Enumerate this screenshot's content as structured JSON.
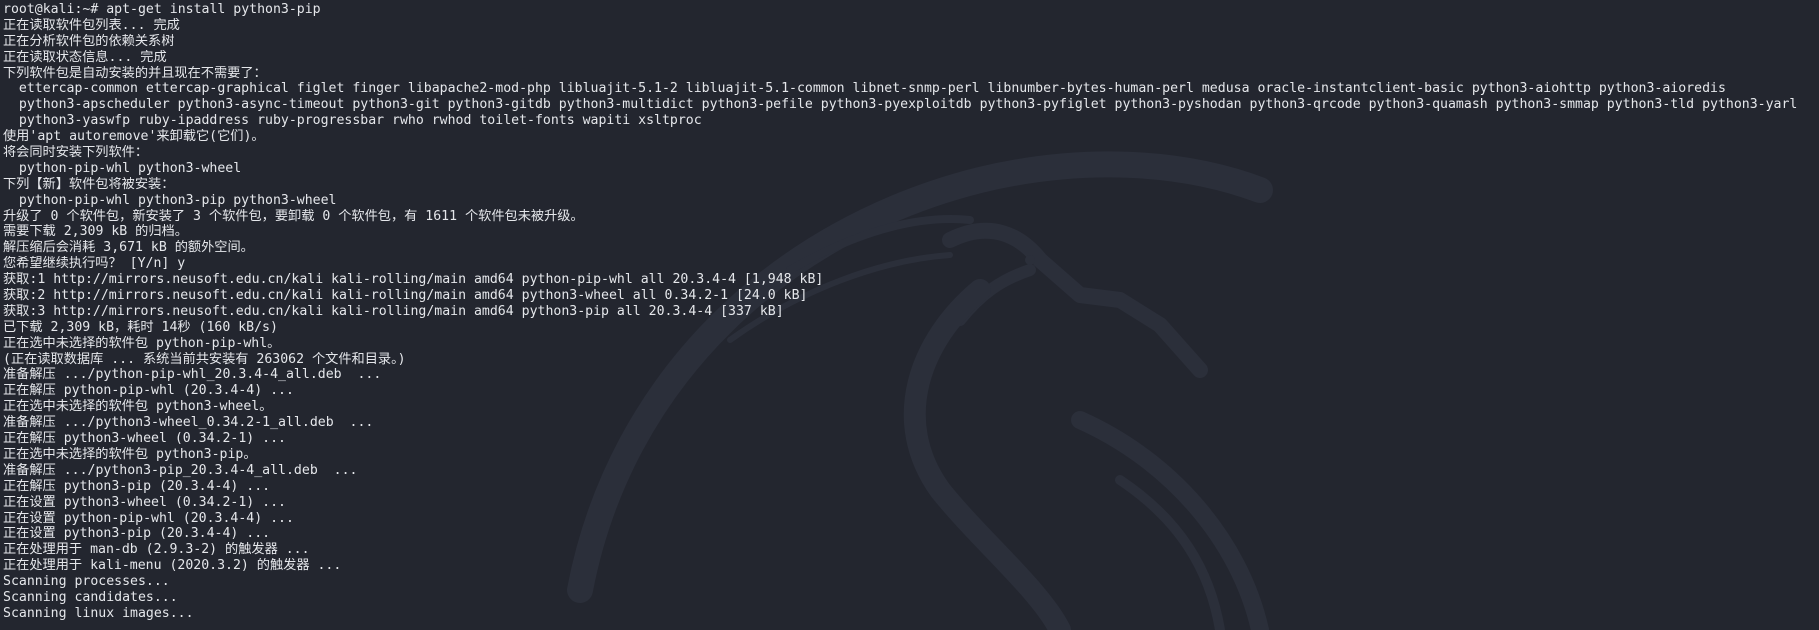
{
  "terminal": {
    "prompt": "root@kali:~#",
    "command": "apt-get install python3-pip",
    "lines": [
      "正在读取软件包列表... 完成",
      "正在分析软件包的依赖关系树",
      "正在读取状态信息... 完成",
      "下列软件包是自动安装的并且现在不需要了：",
      "  ettercap-common ettercap-graphical figlet finger libapache2-mod-php libluajit-5.1-2 libluajit-5.1-common libnet-snmp-perl libnumber-bytes-human-perl medusa oracle-instantclient-basic python3-aiohttp python3-aioredis",
      "  python3-apscheduler python3-async-timeout python3-git python3-gitdb python3-multidict python3-pefile python3-pyexploitdb python3-pyfiglet python3-pyshodan python3-qrcode python3-quamash python3-smmap python3-tld python3-yarl",
      "  python3-yaswfp ruby-ipaddress ruby-progressbar rwho rwhod toilet-fonts wapiti xsltproc",
      "使用'apt autoremove'来卸载它(它们)。",
      "将会同时安装下列软件：",
      "  python-pip-whl python3-wheel",
      "下列【新】软件包将被安装：",
      "  python-pip-whl python3-pip python3-wheel",
      "升级了 0 个软件包，新安装了 3 个软件包，要卸载 0 个软件包，有 1611 个软件包未被升级。",
      "需要下载 2,309 kB 的归档。",
      "解压缩后会消耗 3,671 kB 的额外空间。",
      "您希望继续执行吗？ [Y/n] y",
      "获取:1 http://mirrors.neusoft.edu.cn/kali kali-rolling/main amd64 python-pip-whl all 20.3.4-4 [1,948 kB]",
      "获取:2 http://mirrors.neusoft.edu.cn/kali kali-rolling/main amd64 python3-wheel all 0.34.2-1 [24.0 kB]",
      "获取:3 http://mirrors.neusoft.edu.cn/kali kali-rolling/main amd64 python3-pip all 20.3.4-4 [337 kB]",
      "已下载 2,309 kB，耗时 14秒 (160 kB/s)",
      "正在选中未选择的软件包 python-pip-whl。",
      "(正在读取数据库 ... 系统当前共安装有 263062 个文件和目录。)",
      "准备解压 .../python-pip-whl_20.3.4-4_all.deb  ...",
      "正在解压 python-pip-whl (20.3.4-4) ...",
      "正在选中未选择的软件包 python3-wheel。",
      "准备解压 .../python3-wheel_0.34.2-1_all.deb  ...",
      "正在解压 python3-wheel (0.34.2-1) ...",
      "正在选中未选择的软件包 python3-pip。",
      "准备解压 .../python3-pip_20.3.4-4_all.deb  ...",
      "正在解压 python3-pip (20.3.4-4) ...",
      "正在设置 python3-wheel (0.34.2-1) ...",
      "正在设置 python-pip-whl (20.3.4-4) ...",
      "正在设置 python3-pip (20.3.4-4) ...",
      "正在处理用于 man-db (2.9.3-2) 的触发器 ...",
      "正在处理用于 kali-menu (2020.3.2) 的触发器 ...",
      "Scanning processes...",
      "Scanning candidates...",
      "Scanning linux images..."
    ]
  },
  "colors": {
    "background": "#23262f",
    "text": "#e5e7eb",
    "watermark": "#2c303b"
  },
  "icons": [
    "kali-dragon-watermark"
  ]
}
